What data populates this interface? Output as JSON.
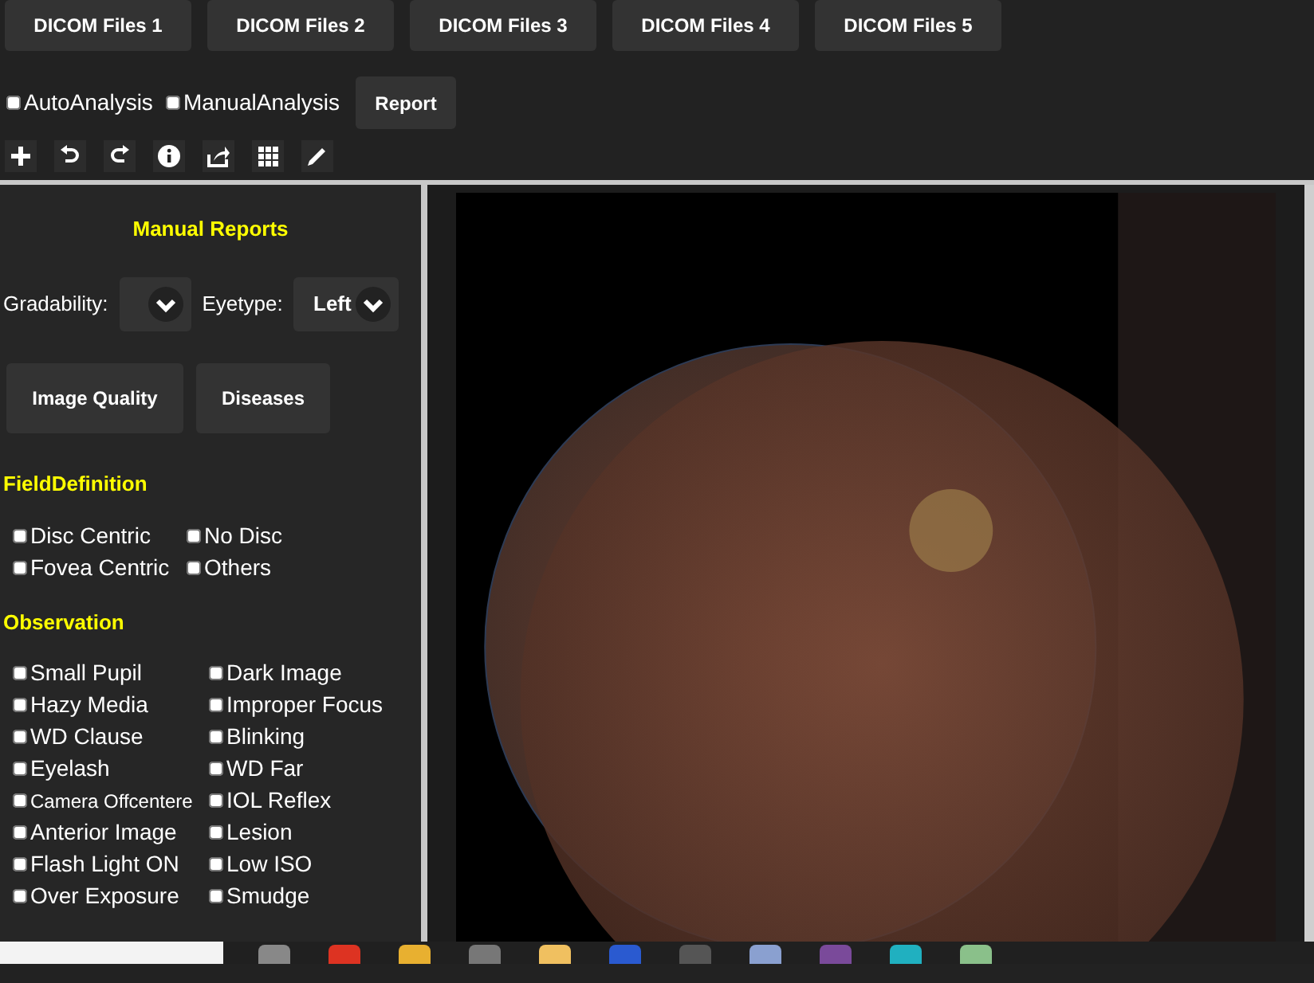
{
  "file_tabs": [
    {
      "label": "DICOM Files 1"
    },
    {
      "label": "DICOM Files 2"
    },
    {
      "label": "DICOM Files 3"
    },
    {
      "label": "DICOM Files 4"
    },
    {
      "label": "DICOM Files 5"
    }
  ],
  "analysis_options": [
    {
      "label": "AutoAnalysis",
      "checked": false
    },
    {
      "label": "ManualAnalysis",
      "checked": false
    }
  ],
  "report_button": "Report",
  "sidebar": {
    "title": "Manual Reports",
    "gradability": {
      "label": "Gradability:"
    },
    "eyetype": {
      "label": "Eyetype:",
      "value": "Left"
    },
    "buttons": [
      "Image Quality",
      "Diseases"
    ],
    "sections": [
      {
        "title": "FieldDefinition",
        "items": [
          {
            "label": "Disc Centric",
            "checked": false
          },
          {
            "label": "No Disc",
            "checked": false
          },
          {
            "label": "Fovea Centric",
            "checked": false
          },
          {
            "label": "Others",
            "checked": false
          }
        ]
      },
      {
        "title": "Observation",
        "items": [
          {
            "label": "Small Pupil",
            "checked": false
          },
          {
            "label": "Dark Image",
            "checked": false
          },
          {
            "label": "Hazy Media",
            "checked": false
          },
          {
            "label": "Improper Focus",
            "checked": false
          },
          {
            "label": "WD Clause",
            "checked": false
          },
          {
            "label": "Blinking",
            "checked": false
          },
          {
            "label": "Eyelash",
            "checked": false
          },
          {
            "label": "WD Far",
            "checked": false
          },
          {
            "label": "Camera Offcentere",
            "checked": false
          },
          {
            "label": "IOL Reflex",
            "checked": false
          },
          {
            "label": "Anterior Image",
            "checked": false
          },
          {
            "label": "Lesion",
            "checked": false
          },
          {
            "label": "Flash Light ON",
            "checked": false
          },
          {
            "label": "Low ISO",
            "checked": false
          },
          {
            "label": "Over Exposure",
            "checked": false
          },
          {
            "label": "Smudge",
            "checked": false
          }
        ]
      }
    ]
  }
}
